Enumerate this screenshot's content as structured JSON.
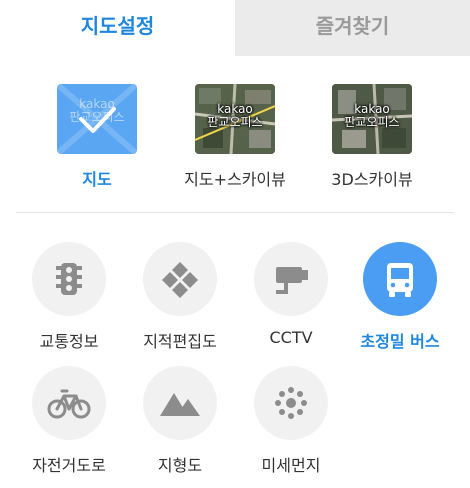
{
  "tabs": {
    "active": "지도설정",
    "inactive": "즐겨찾기"
  },
  "map_types": [
    {
      "label": "지도",
      "thumb_text": "kakao\n판교오피스",
      "selected": true
    },
    {
      "label": "지도+스카이뷰",
      "thumb_text": "kakao\n판교오피스",
      "selected": false
    },
    {
      "label": "3D스카이뷰",
      "thumb_text": "kakao\n판교오피스",
      "selected": false
    }
  ],
  "layers": [
    {
      "label": "교통정보",
      "icon": "traffic-light-icon",
      "selected": false
    },
    {
      "label": "지적편집도",
      "icon": "cadastral-grid-icon",
      "selected": false
    },
    {
      "label": "CCTV",
      "icon": "cctv-camera-icon",
      "selected": false
    },
    {
      "label": "초정밀 버스",
      "icon": "bus-icon",
      "selected": true
    },
    {
      "label": "자전거도로",
      "icon": "bicycle-icon",
      "selected": false
    },
    {
      "label": "지형도",
      "icon": "mountain-icon",
      "selected": false
    },
    {
      "label": "미세먼지",
      "icon": "fine-dust-icon",
      "selected": false
    }
  ],
  "colors": {
    "accent": "#1f86e0",
    "selected_circle": "#4a9df2",
    "icon_gray": "#8c8c8c"
  }
}
